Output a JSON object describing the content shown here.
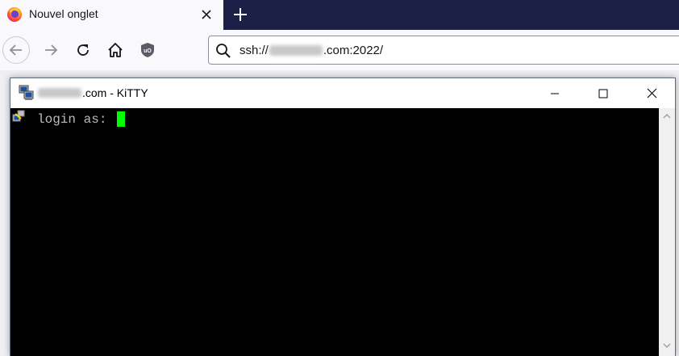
{
  "browser": {
    "tab": {
      "title": "Nouvel onglet",
      "favicon": "firefox-logo-icon",
      "close_icon": "close-icon"
    },
    "newtab_icon": "plus-icon",
    "nav": {
      "back_icon": "arrow-left-icon",
      "forward_icon": "arrow-right-icon",
      "reload_icon": "reload-icon",
      "home_icon": "home-icon",
      "extension_icon": "ublock-origin-icon"
    },
    "urlbar": {
      "search_icon": "search-icon",
      "prefix": "ssh://",
      "suffix": ".com:2022/"
    },
    "colors": {
      "tabstrip": "#1d2046",
      "toolbar": "#f9f9fb"
    }
  },
  "kitty": {
    "title_suffix": ".com - KiTTY",
    "app_icon": "putty-computers-icon",
    "controls": {
      "minimize_icon": "minimize-icon",
      "maximize_icon": "maximize-icon",
      "close_icon": "close-icon"
    },
    "terminal": {
      "prompt": "login as: ",
      "cursor_color": "#00ff00",
      "background": "#000000",
      "text_color": "#bbbbbb"
    },
    "scrollbar": {
      "up_icon": "chevron-up-icon",
      "down_icon": "chevron-down-icon"
    }
  }
}
